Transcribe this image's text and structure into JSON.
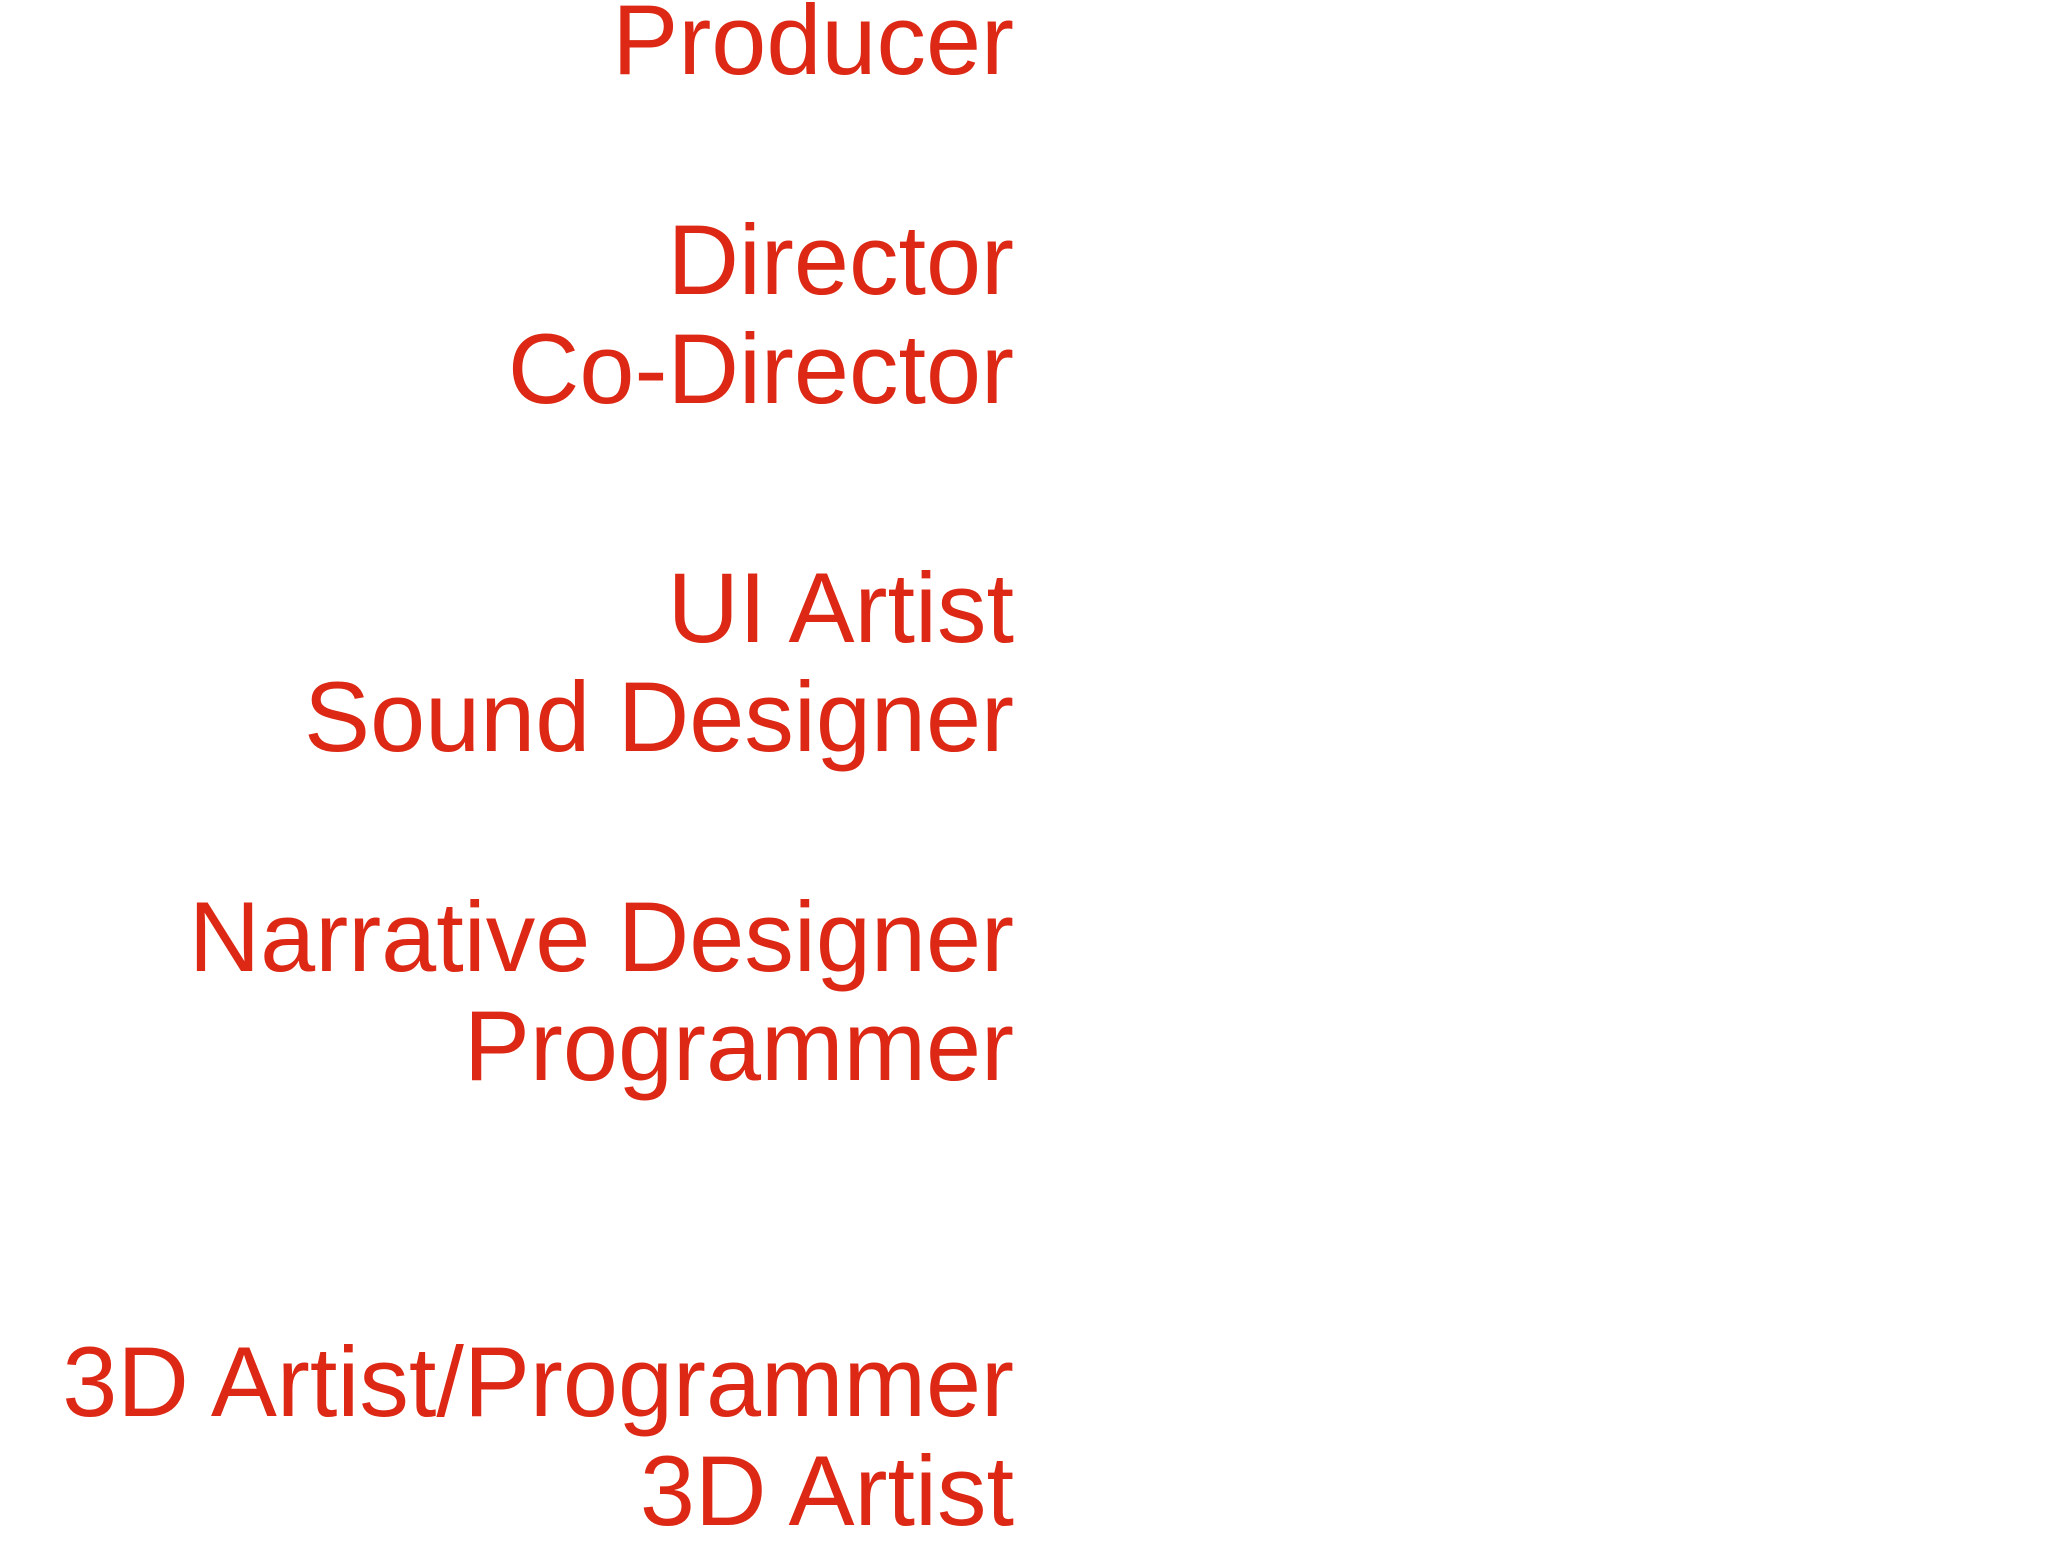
{
  "credits": {
    "roles": [
      "Producer",
      "Director",
      "Co-Director",
      "UI Artist",
      "Sound Designer",
      "Narrative Designer",
      "Programmer",
      "3D Artist/Programmer",
      "3D Artist"
    ],
    "text_color": "#dc2814",
    "background_color": "#ffffff"
  }
}
